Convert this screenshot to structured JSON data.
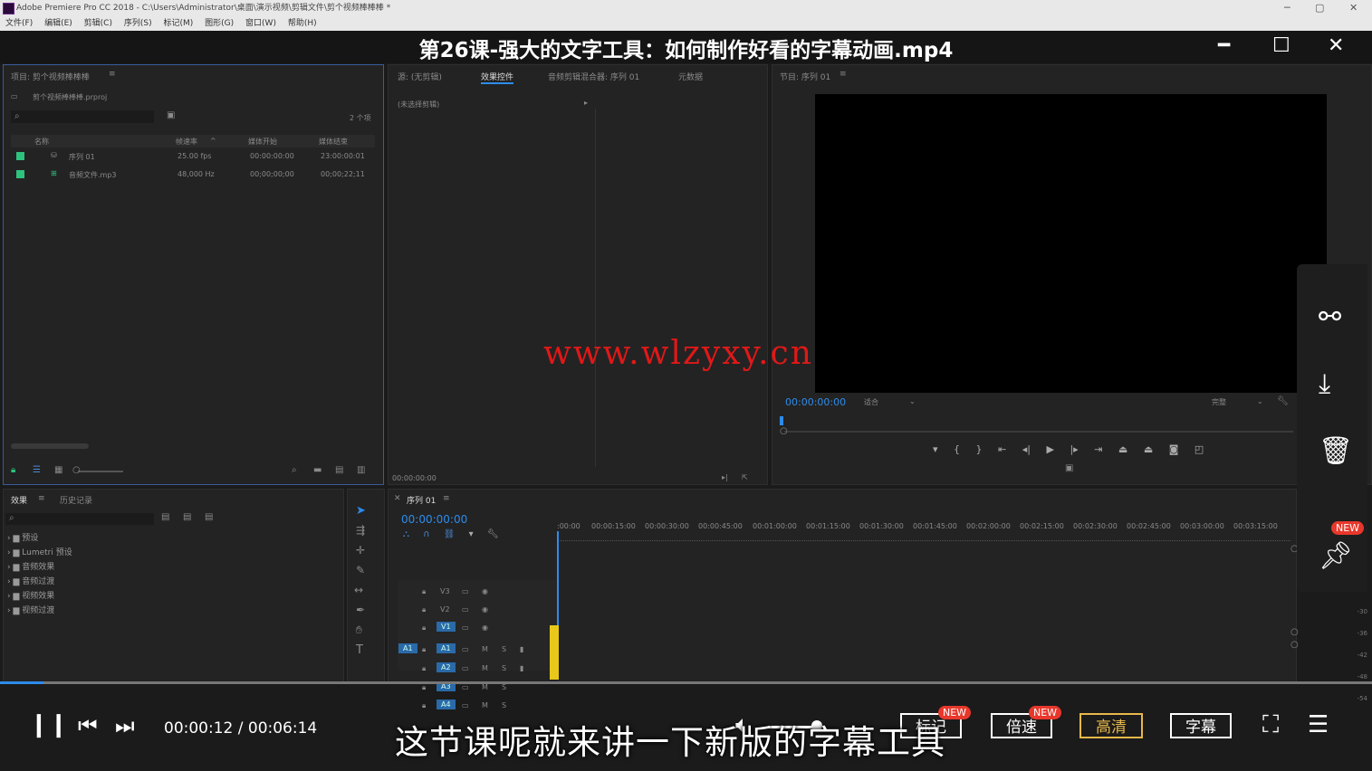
{
  "window": {
    "title": "Adobe Premiere Pro CC 2018 - C:\\Users\\Administrator\\桌面\\演示视频\\剪辑文件\\剪个视频棒棒棒 *",
    "controls": [
      "─",
      "▢",
      "✕"
    ]
  },
  "menu": [
    "文件(F)",
    "编辑(E)",
    "剪辑(C)",
    "序列(S)",
    "标记(M)",
    "图形(G)",
    "窗口(W)",
    "帮助(H)"
  ],
  "video_title": "第26课-强大的文字工具：如何制作好看的字幕动画.mp4",
  "project_panel": {
    "tab": "项目: 剪个视频棒棒棒",
    "file": "剪个视频棒棒棒.prproj",
    "count": "2 个项",
    "columns": [
      "名称",
      "帧速率",
      "媒体开始",
      "媒体结束"
    ],
    "rows": [
      {
        "name": "序列 01",
        "rate": "25.00 fps",
        "start": "00:00:00:00",
        "end": "23:00:00:01"
      },
      {
        "name": "音频文件.mp3",
        "rate": "48,000 Hz",
        "start": "00;00;00;00",
        "end": "00;00;22;11"
      }
    ]
  },
  "effect_controls": {
    "tabs": [
      "源: (无剪辑)",
      "效果控件",
      "音频剪辑混合器: 序列 01",
      "元数据"
    ],
    "no_clip": "(未选择剪辑)",
    "timecode": "00:00:00:00"
  },
  "program_monitor": {
    "tab": "节目: 序列 01",
    "timecode": "00:00:00:00",
    "fit": "适合",
    "quality": "完整"
  },
  "watermark": "www.wlzyxy.cn",
  "effects_panel": {
    "tabs": [
      "效果",
      "历史记录"
    ],
    "items": [
      "预设",
      "Lumetri 预设",
      "音频效果",
      "音频过渡",
      "视频效果",
      "视频过渡"
    ]
  },
  "timeline": {
    "tab": "序列 01",
    "timecode": "00:00:00:00",
    "ruler": [
      ":00:00",
      "00:00:15:00",
      "00:00:30:00",
      "00:00:45:00",
      "00:01:00:00",
      "00:01:15:00",
      "00:01:30:00",
      "00:01:45:00",
      "00:02:00:00",
      "00:02:15:00",
      "00:02:30:00",
      "00:02:45:00",
      "00:03:00:00",
      "00:03:15:00"
    ],
    "tracks": [
      "V3",
      "V2",
      "V1",
      "A1",
      "A2",
      "A3",
      "A4"
    ]
  },
  "player": {
    "time": "00:00:12 / 00:06:14",
    "progress": 0.032,
    "buttons": {
      "mark": "标记",
      "speed": "倍速",
      "hd": "高清",
      "subtitle": "字幕"
    },
    "new_badge": "NEW",
    "caption": "这节课呢就来讲一下新版的字幕工具"
  },
  "colors": {
    "accent_blue": "#2d8ceb",
    "badge_red": "#e8382c",
    "hd_gold": "#e8b84a"
  }
}
